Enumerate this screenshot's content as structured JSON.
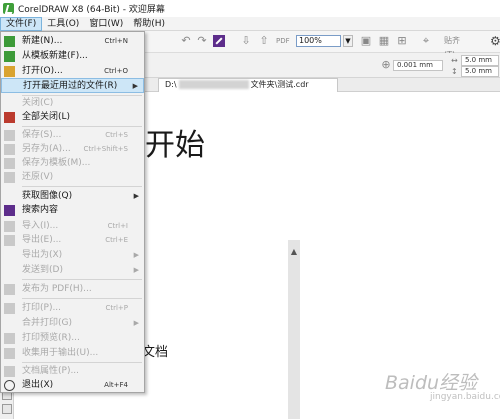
{
  "window": {
    "title": "CorelDRAW X8 (64-Bit) - 欢迎屏幕"
  },
  "menubar": {
    "items": [
      {
        "label": "文件(F)"
      },
      {
        "label": "工具(O)"
      },
      {
        "label": "窗口(W)"
      },
      {
        "label": "帮助(H)"
      }
    ]
  },
  "toolbar": {
    "zoom_value": "100%",
    "snap_label": "贴齐(T)",
    "nudge_value": "0.001 mm",
    "dup_x": "5.0 mm",
    "dup_y": "5.0 mm"
  },
  "document_tab": {
    "prefix": "D:\\",
    "suffix": "文件夹\\测试.cdr"
  },
  "file_menu": {
    "items": [
      {
        "label": "新建(N)...",
        "shortcut": "Ctrl+N",
        "icon": "new-document-icon",
        "disabled": false
      },
      {
        "label": "从模板新建(F)...",
        "shortcut": "",
        "icon": "new-from-template-icon",
        "disabled": false
      },
      {
        "label": "打开(O)...",
        "shortcut": "Ctrl+O",
        "icon": "open-folder-icon",
        "disabled": false
      },
      {
        "label": "打开最近用过的文件(R)",
        "shortcut": "",
        "icon": "",
        "disabled": false,
        "submenu": true,
        "highlighted": true
      },
      {
        "label": "关闭(C)",
        "shortcut": "",
        "icon": "",
        "disabled": true
      },
      {
        "label": "全部关闭(L)",
        "shortcut": "",
        "icon": "close-all-icon",
        "disabled": false
      },
      {
        "label": "保存(S)...",
        "shortcut": "Ctrl+S",
        "icon": "save-icon",
        "disabled": true
      },
      {
        "label": "另存为(A)...",
        "shortcut": "Ctrl+Shift+S",
        "icon": "save-as-icon",
        "disabled": true
      },
      {
        "label": "保存为模板(M)...",
        "shortcut": "",
        "icon": "save-template-icon",
        "disabled": true
      },
      {
        "label": "还原(V)",
        "shortcut": "",
        "icon": "revert-icon",
        "disabled": true
      },
      {
        "label": "获取图像(Q)",
        "shortcut": "",
        "icon": "",
        "disabled": false,
        "submenu": true
      },
      {
        "label": "搜索内容",
        "shortcut": "",
        "icon": "search-content-icon",
        "disabled": false
      },
      {
        "label": "导入(I)...",
        "shortcut": "Ctrl+I",
        "icon": "import-icon",
        "disabled": true
      },
      {
        "label": "导出(E)...",
        "shortcut": "Ctrl+E",
        "icon": "export-icon",
        "disabled": true
      },
      {
        "label": "导出为(X)",
        "shortcut": "",
        "icon": "",
        "disabled": true,
        "submenu": true
      },
      {
        "label": "发送到(D)",
        "shortcut": "",
        "icon": "",
        "disabled": true,
        "submenu": true
      },
      {
        "label": "发布为 PDF(H)...",
        "shortcut": "",
        "icon": "pdf-icon",
        "disabled": true
      },
      {
        "label": "打印(P)...",
        "shortcut": "Ctrl+P",
        "icon": "print-icon",
        "disabled": true
      },
      {
        "label": "合并打印(G)",
        "shortcut": "",
        "icon": "",
        "disabled": true,
        "submenu": true
      },
      {
        "label": "打印预览(R)...",
        "shortcut": "",
        "icon": "print-preview-icon",
        "disabled": true
      },
      {
        "label": "收集用于输出(U)...",
        "shortcut": "",
        "icon": "collect-output-icon",
        "disabled": true
      },
      {
        "label": "文档属性(P)...",
        "shortcut": "",
        "icon": "document-properties-icon",
        "disabled": true
      },
      {
        "label": "退出(X)",
        "shortcut": "Alt+F4",
        "icon": "exit-icon",
        "disabled": false
      }
    ]
  },
  "canvas": {
    "welcome_heading": "开始",
    "recent_docs_label": "的文档"
  },
  "watermark": {
    "text": "Baidu经验",
    "sub": "jingyan.baidu.com"
  }
}
